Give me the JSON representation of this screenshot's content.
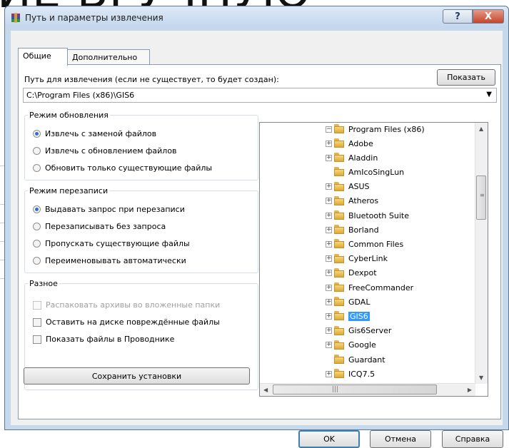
{
  "background": {
    "text": "ИЕ ВРУЧНУЮ"
  },
  "window": {
    "title": "Путь и параметры извлечения",
    "help_glyph": "?",
    "close_glyph": "X"
  },
  "tabs": [
    {
      "label": "Общие"
    },
    {
      "label": "Дополнительно"
    }
  ],
  "path": {
    "label": "Путь для извлечения (если не существует, то будет создан):",
    "show_button": "Показать",
    "value": "C:\\Program Files (x86)\\GIS6"
  },
  "update_mode": {
    "title": "Режим обновления",
    "options": [
      {
        "label": "Извлечь с заменой файлов",
        "selected": true
      },
      {
        "label": "Извлечь с обновлением файлов",
        "selected": false
      },
      {
        "label": "Обновить только существующие файлы",
        "selected": false
      }
    ]
  },
  "overwrite_mode": {
    "title": "Режим перезаписи",
    "options": [
      {
        "label": "Выдавать запрос при перезаписи",
        "selected": true
      },
      {
        "label": "Перезаписывать без запроса",
        "selected": false
      },
      {
        "label": "Пропускать существующие файлы",
        "selected": false
      },
      {
        "label": "Переименовывать автоматически",
        "selected": false
      }
    ]
  },
  "misc": {
    "title": "Разное",
    "options": [
      {
        "label": "Распаковать архивы во вложенные папки",
        "checked": false,
        "disabled": true
      },
      {
        "label": "Оставить на диске повреждённые файлы",
        "checked": false,
        "disabled": false
      },
      {
        "label": "Показать файлы в Проводнике",
        "checked": false,
        "disabled": false
      }
    ]
  },
  "save_button": "Сохранить установки",
  "tree": {
    "root": "Program Files (x86)",
    "items": [
      "Adobe",
      "Aladdin",
      "AmIcoSingLun",
      "ASUS",
      "Atheros",
      "Bluetooth Suite",
      "Borland",
      "Common Files",
      "CyberLink",
      "Dexpot",
      "FreeCommander",
      "GDAL",
      "GIS6",
      "Gis6Server",
      "Google",
      "Guardant",
      "ICQ7.5"
    ],
    "selected": "GIS6",
    "hscroll_grip": "|||",
    "vscroll_grip": "≡"
  },
  "buttons": {
    "ok": "OK",
    "cancel": "Отмена",
    "help": "Справка"
  }
}
